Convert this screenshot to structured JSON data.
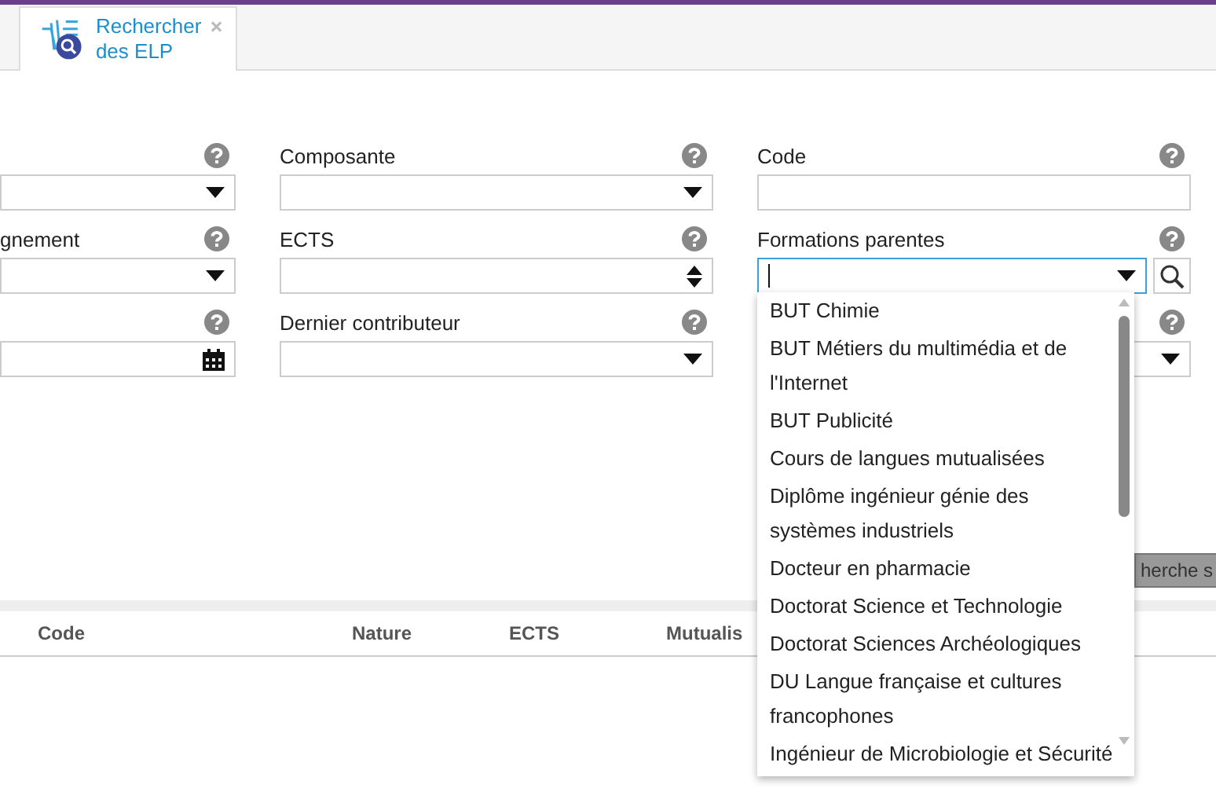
{
  "tab": {
    "label": "Rechercher des ELP",
    "selected": true
  },
  "form_rows": [
    [
      {
        "kind": "select"
      },
      {
        "label": "Composante",
        "kind": "select"
      },
      {
        "label": "Code",
        "kind": "text"
      }
    ],
    [
      {
        "label": "gnement",
        "kind": "select"
      },
      {
        "label": "ECTS",
        "kind": "spin"
      },
      {
        "label": "Formations parentes",
        "kind": "combo",
        "focused": true
      }
    ],
    [
      {
        "kind": "date"
      },
      {
        "label": "Dernier contributeur",
        "kind": "select"
      },
      {
        "kind": "select"
      }
    ]
  ],
  "search_button": "herche s",
  "table": {
    "columns": [
      "Code",
      "Nature",
      "ECTS",
      "Mutualis"
    ]
  },
  "dropdown": {
    "items": [
      "BUT Chimie",
      "BUT Métiers du multimédia et de l'Internet",
      "BUT Publicité",
      "Cours de langues mutualisées",
      "Diplôme ingénieur génie des systèmes industriels",
      "Docteur en pharmacie",
      "Doctorat Science et Technologie",
      "Doctorat Sciences Archéologiques",
      "DU Langue française et cultures francophones",
      "Ingénieur de Microbiologie et Sécurité"
    ]
  }
}
